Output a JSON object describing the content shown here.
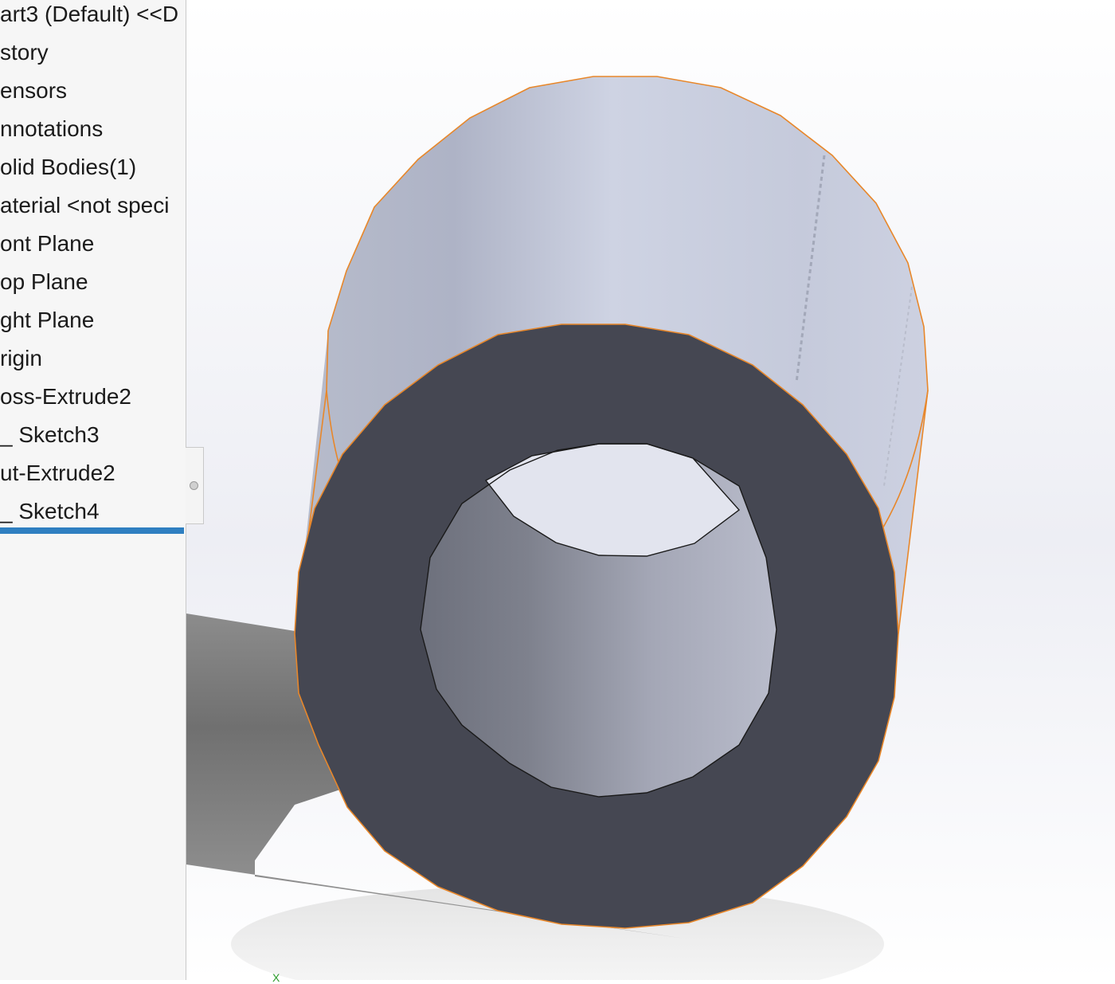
{
  "feature_tree": {
    "items": [
      {
        "label": "art3 (Default) <<D"
      },
      {
        "label": "story"
      },
      {
        "label": "ensors"
      },
      {
        "label": "nnotations"
      },
      {
        "label": "olid Bodies(1)"
      },
      {
        "label": "aterial <not speci"
      },
      {
        "label": "ont Plane"
      },
      {
        "label": "op Plane"
      },
      {
        "label": "ght Plane"
      },
      {
        "label": "rigin"
      },
      {
        "label": "oss-Extrude2"
      },
      {
        "label": "_ Sketch3"
      },
      {
        "label": "ut-Extrude2"
      },
      {
        "label": "_ Sketch4"
      }
    ],
    "selected": "_ Sketch4"
  },
  "viewport": {
    "model": "hollow cylinder",
    "triad_label": "X",
    "colors": {
      "background": "#ffffff",
      "cylinder_body": "#c9cedd",
      "end_face": "#454752",
      "edge_highlight": "#e8872a",
      "selection": "#2f7fc1"
    }
  }
}
